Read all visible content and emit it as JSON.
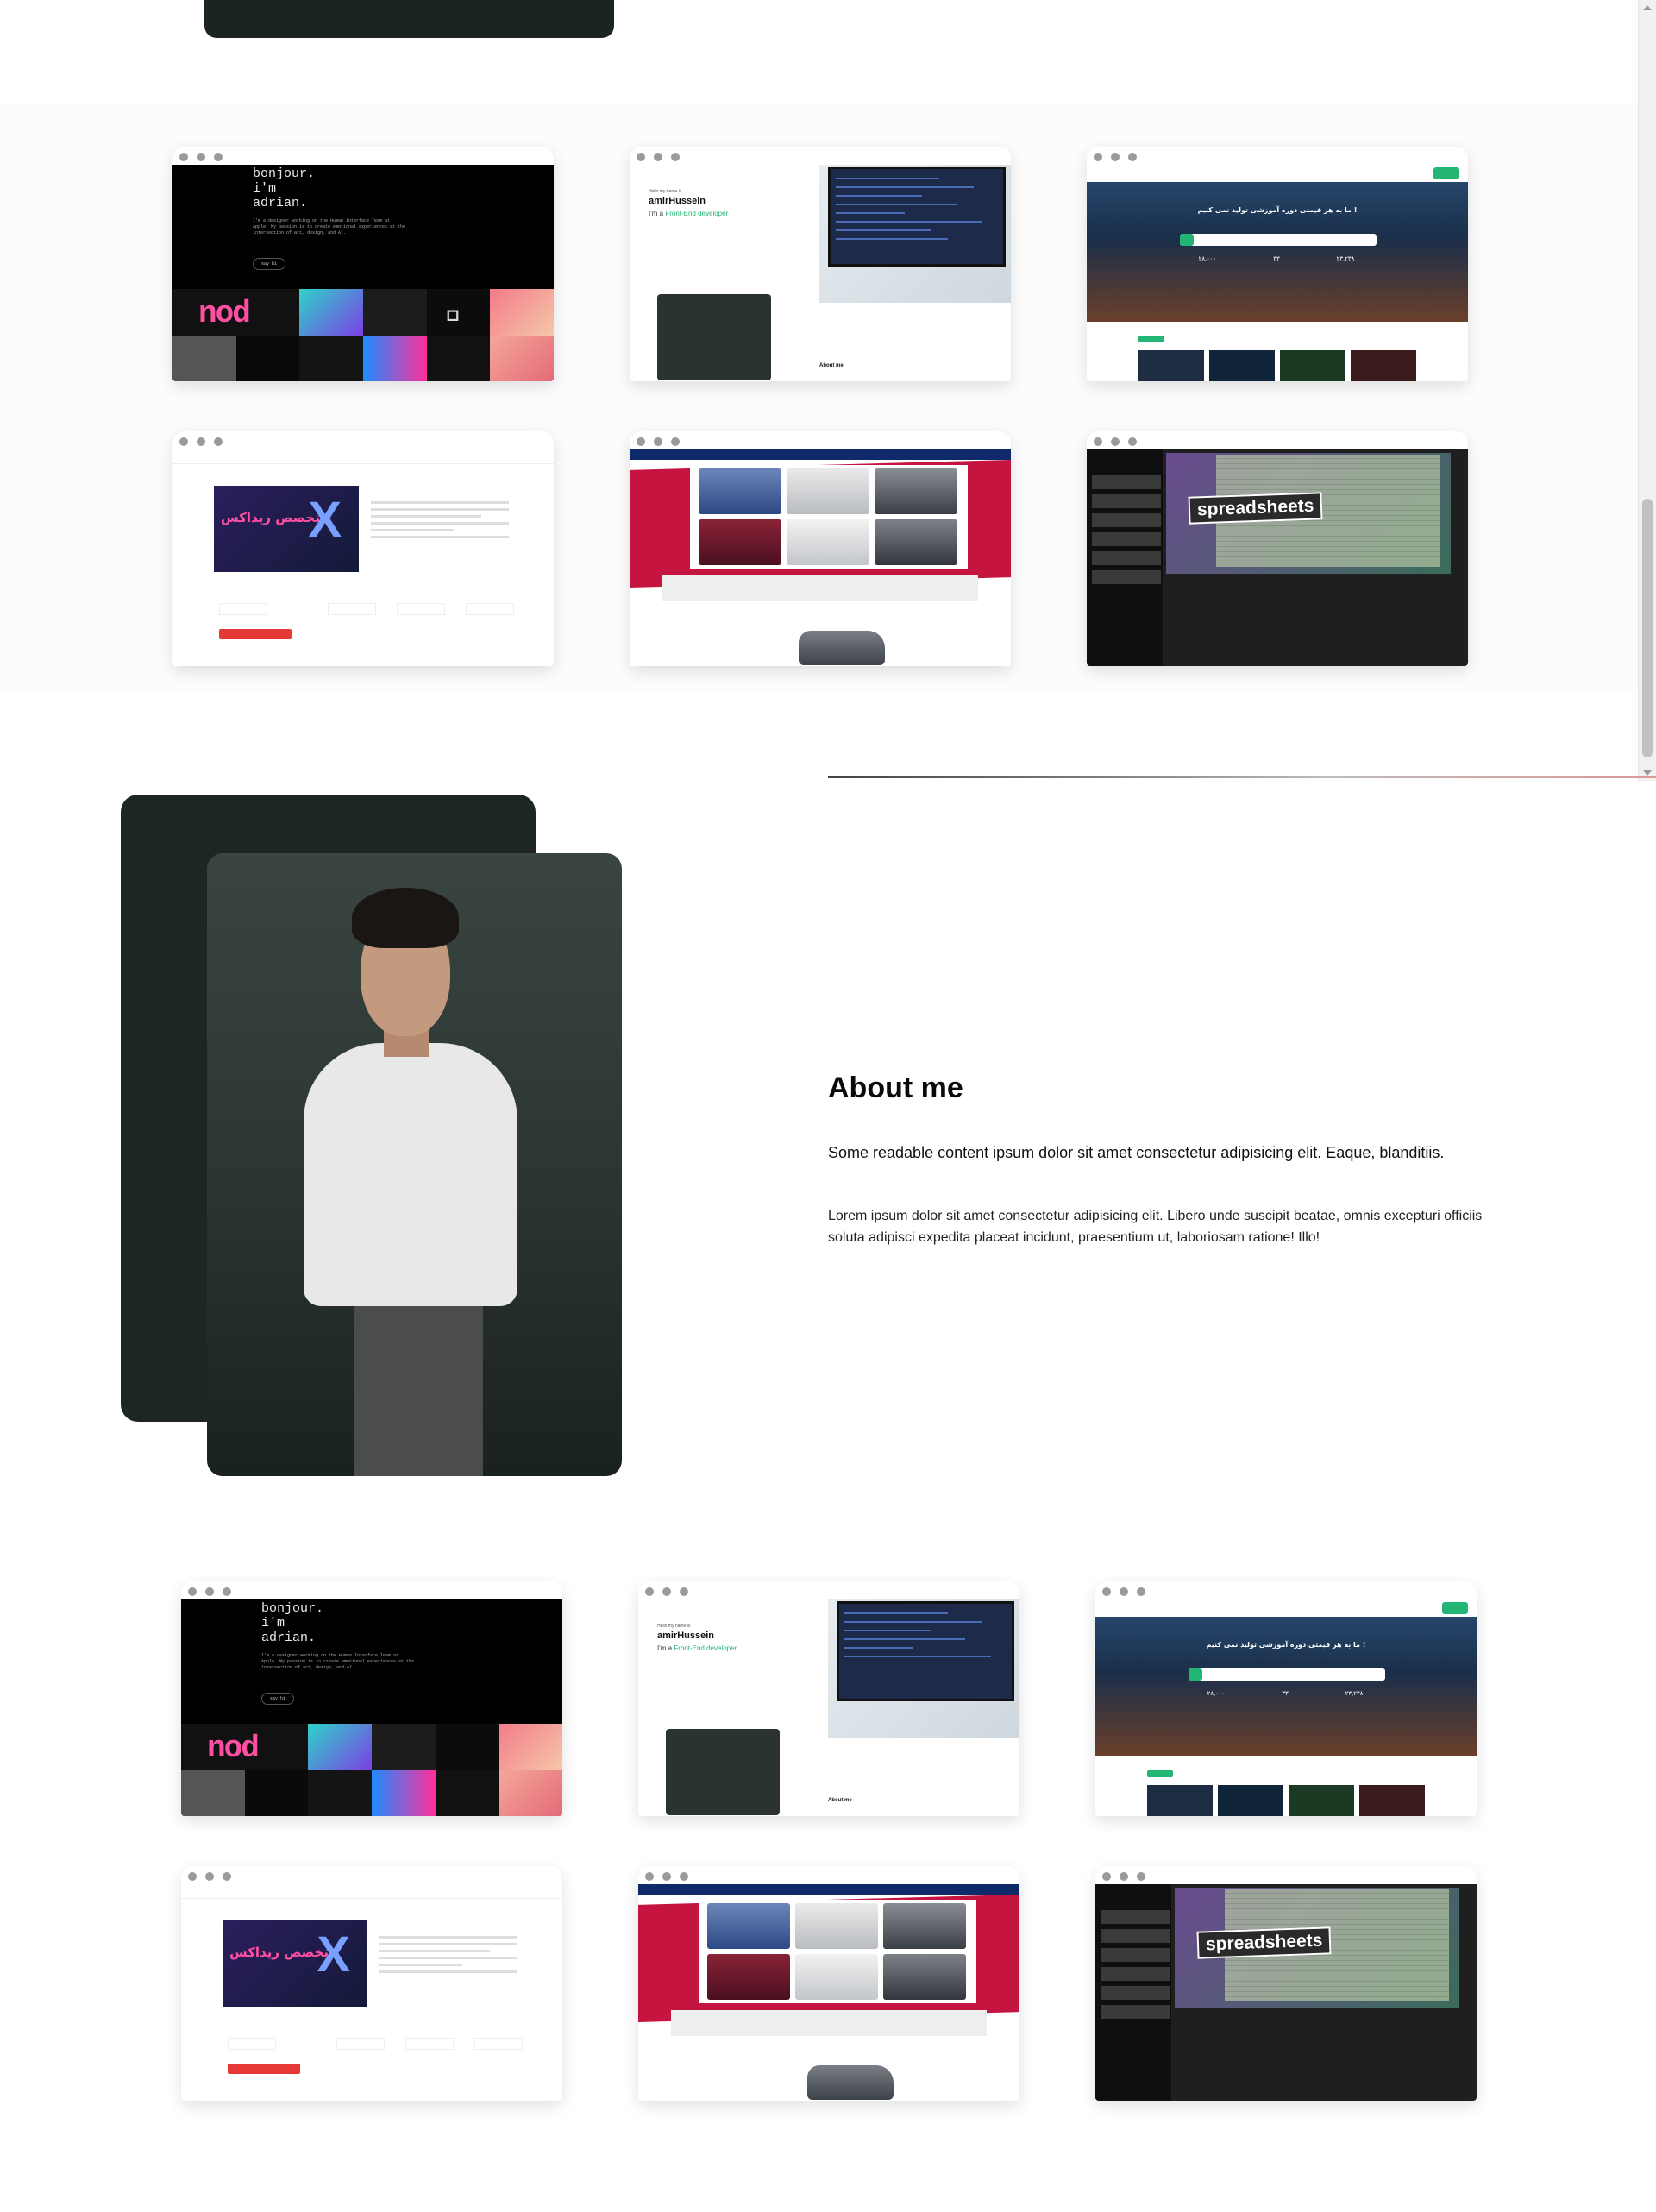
{
  "about": {
    "title": "About me",
    "paragraph1": "Some readable content ipsum dolor sit amet consectetur adipisicing elit. Eaque, blanditiis.",
    "paragraph2": "Lorem ipsum dolor sit amet consectetur adipisicing elit. Libero unde suscipit beatae, omnis excepturi officiis soluta adipisci expedita placeat incidunt, praesentium ut, laboriosam ratione! Illo!"
  },
  "preview_text": {
    "adrian_greeting": "bonjour.\ni'm\nadrian.",
    "adrian_button": "say hi",
    "adrian_sub": "I'm a designer working on the Human Interface Team at Apple. My passion is to create emotional experiences at the intersection of art, design, and AI.",
    "amir_hello": "Hello my name is",
    "amir_name": "amirHussein",
    "amir_role_prefix": "I'm a ",
    "amir_role": "Front-End developer",
    "amir_about": "About me",
    "persian_hero": "ما به هر قیمتی دوره آموزشی تولید نمی کنیم !",
    "persian_stats": [
      "۲۸,۰۰۰",
      "۳۳",
      "۲۳,۲۳۸"
    ],
    "course_banner": "متخصص ریداکس",
    "course_x": "X",
    "spreadsheets_label": "spreadsheets"
  },
  "colors": {
    "accent_green": "#22b573",
    "dark_photo": "#1e2624",
    "cars_red": "#c4143f",
    "cars_blue": "#0f2a6b"
  },
  "icons": [
    "window-dot",
    "scroll-up-arrow",
    "scroll-down-arrow"
  ]
}
